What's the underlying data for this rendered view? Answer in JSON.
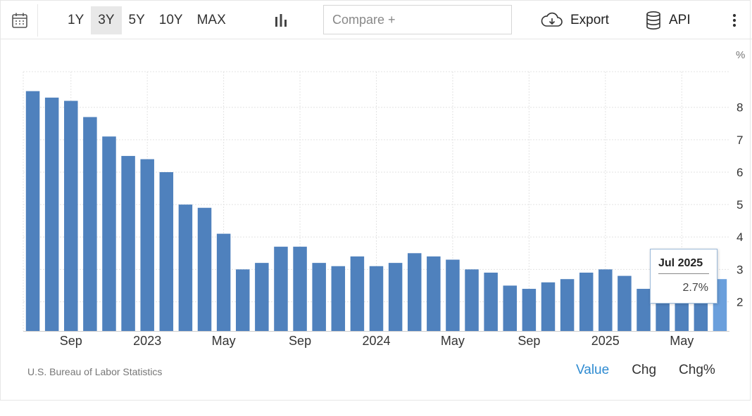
{
  "toolbar": {
    "ranges": [
      "1Y",
      "3Y",
      "5Y",
      "10Y",
      "MAX"
    ],
    "active_range": "3Y",
    "compare_placeholder": "Compare +",
    "export_label": "Export",
    "api_label": "API"
  },
  "icons": {
    "calendar": "calendar-icon",
    "chart_type": "bar-chart-icon",
    "export": "cloud-download-icon",
    "api": "database-icon",
    "more": "vertical-dots-icon"
  },
  "colors": {
    "bar": "#4f81bd",
    "bar_highlight": "#6a9fdc",
    "active_tab": "#2e8bd1",
    "grid": "#e3e3e3"
  },
  "chart_data": {
    "type": "bar",
    "unit": "%",
    "x": [
      "2022-07",
      "2022-08",
      "2022-09",
      "2022-10",
      "2022-11",
      "2022-12",
      "2023-01",
      "2023-02",
      "2023-03",
      "2023-04",
      "2023-05",
      "2023-06",
      "2023-07",
      "2023-08",
      "2023-09",
      "2023-10",
      "2023-11",
      "2023-12",
      "2024-01",
      "2024-02",
      "2024-03",
      "2024-04",
      "2024-05",
      "2024-06",
      "2024-07",
      "2024-08",
      "2024-09",
      "2024-10",
      "2024-11",
      "2024-12",
      "2025-01",
      "2025-02",
      "2025-03",
      "2025-04",
      "2025-05",
      "2025-06",
      "2025-07"
    ],
    "values": [
      8.5,
      8.3,
      8.2,
      7.7,
      7.1,
      6.5,
      6.4,
      6.0,
      5.0,
      4.9,
      4.1,
      3.0,
      3.2,
      3.7,
      3.7,
      3.2,
      3.1,
      3.4,
      3.1,
      3.2,
      3.5,
      3.4,
      3.3,
      3.0,
      2.9,
      2.5,
      2.4,
      2.6,
      2.7,
      2.9,
      3.0,
      2.8,
      2.4,
      2.3,
      2.4,
      2.7,
      2.7
    ],
    "x_tick_labels": [
      {
        "label": "Sep",
        "index": 2
      },
      {
        "label": "2023",
        "index": 6
      },
      {
        "label": "May",
        "index": 10
      },
      {
        "label": "Sep",
        "index": 14
      },
      {
        "label": "2024",
        "index": 18
      },
      {
        "label": "May",
        "index": 22
      },
      {
        "label": "Sep",
        "index": 26
      },
      {
        "label": "2025",
        "index": 30
      },
      {
        "label": "May",
        "index": 34
      }
    ],
    "y_ticks": [
      2,
      3,
      4,
      5,
      6,
      7,
      8
    ],
    "ylim": [
      1.1,
      9.1
    ],
    "grid": true,
    "y_axis_side": "right",
    "highlighted_index": 36,
    "tooltip": {
      "title": "Jul 2025",
      "value": "2.7%"
    }
  },
  "footer": {
    "source": "U.S. Bureau of Labor Statistics",
    "tabs": [
      "Value",
      "Chg",
      "Chg%"
    ],
    "active_tab": "Value"
  }
}
